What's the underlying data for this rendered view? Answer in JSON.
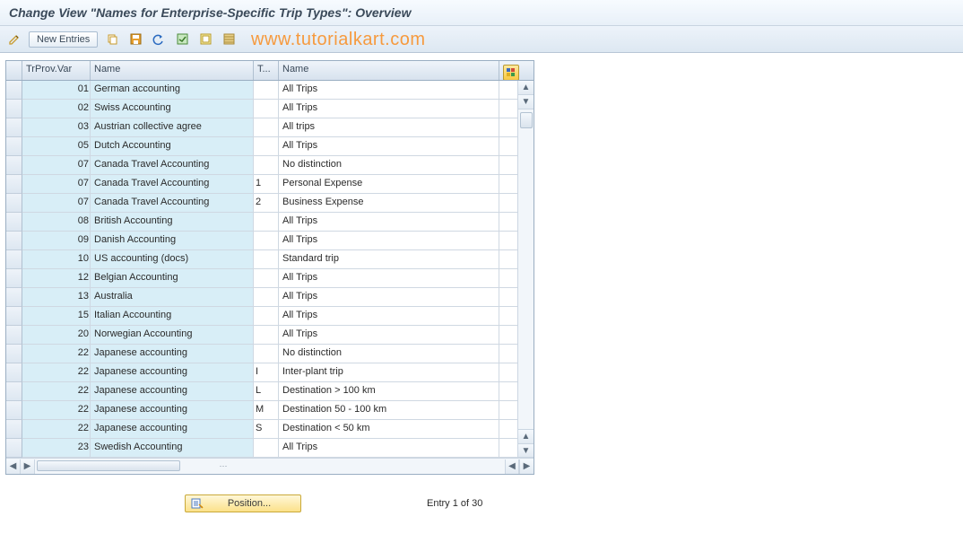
{
  "title": "Change View \"Names for Enterprise-Specific Trip Types\": Overview",
  "watermark": "www.tutorialkart.com",
  "toolbar": {
    "new_entries": "New Entries"
  },
  "columns": {
    "trprov": "TrProv.Var",
    "name1": "Name",
    "t": "T...",
    "name2": "Name"
  },
  "rows": [
    {
      "var": "01",
      "name1": "German accounting",
      "t": "",
      "name2": "All Trips"
    },
    {
      "var": "02",
      "name1": "Swiss Accounting",
      "t": "",
      "name2": "All Trips"
    },
    {
      "var": "03",
      "name1": "Austrian collective agree",
      "t": "",
      "name2": "All trips"
    },
    {
      "var": "05",
      "name1": "Dutch Accounting",
      "t": "",
      "name2": "All Trips"
    },
    {
      "var": "07",
      "name1": "Canada Travel Accounting",
      "t": "",
      "name2": "No distinction"
    },
    {
      "var": "07",
      "name1": "Canada Travel Accounting",
      "t": "1",
      "name2": "Personal Expense"
    },
    {
      "var": "07",
      "name1": "Canada Travel Accounting",
      "t": "2",
      "name2": "Business Expense"
    },
    {
      "var": "08",
      "name1": "British Accounting",
      "t": "",
      "name2": "All Trips"
    },
    {
      "var": "09",
      "name1": "Danish Accounting",
      "t": "",
      "name2": "All Trips"
    },
    {
      "var": "10",
      "name1": "US accounting (docs)",
      "t": "",
      "name2": "Standard trip"
    },
    {
      "var": "12",
      "name1": "Belgian Accounting",
      "t": "",
      "name2": "All Trips"
    },
    {
      "var": "13",
      "name1": "Australia",
      "t": "",
      "name2": "All Trips"
    },
    {
      "var": "15",
      "name1": "Italian Accounting",
      "t": "",
      "name2": "All Trips"
    },
    {
      "var": "20",
      "name1": "Norwegian Accounting",
      "t": "",
      "name2": "All Trips"
    },
    {
      "var": "22",
      "name1": "Japanese accounting",
      "t": "",
      "name2": "No distinction"
    },
    {
      "var": "22",
      "name1": "Japanese accounting",
      "t": "I",
      "name2": "Inter-plant trip"
    },
    {
      "var": "22",
      "name1": "Japanese accounting",
      "t": "L",
      "name2": "Destination > 100 km"
    },
    {
      "var": "22",
      "name1": "Japanese accounting",
      "t": "M",
      "name2": "Destination 50 - 100 km"
    },
    {
      "var": "22",
      "name1": "Japanese accounting",
      "t": "S",
      "name2": "Destination < 50 km"
    },
    {
      "var": "23",
      "name1": "Swedish Accounting",
      "t": "",
      "name2": "All Trips"
    }
  ],
  "footer": {
    "position_label": "Position...",
    "entry_status": "Entry 1 of 30"
  }
}
